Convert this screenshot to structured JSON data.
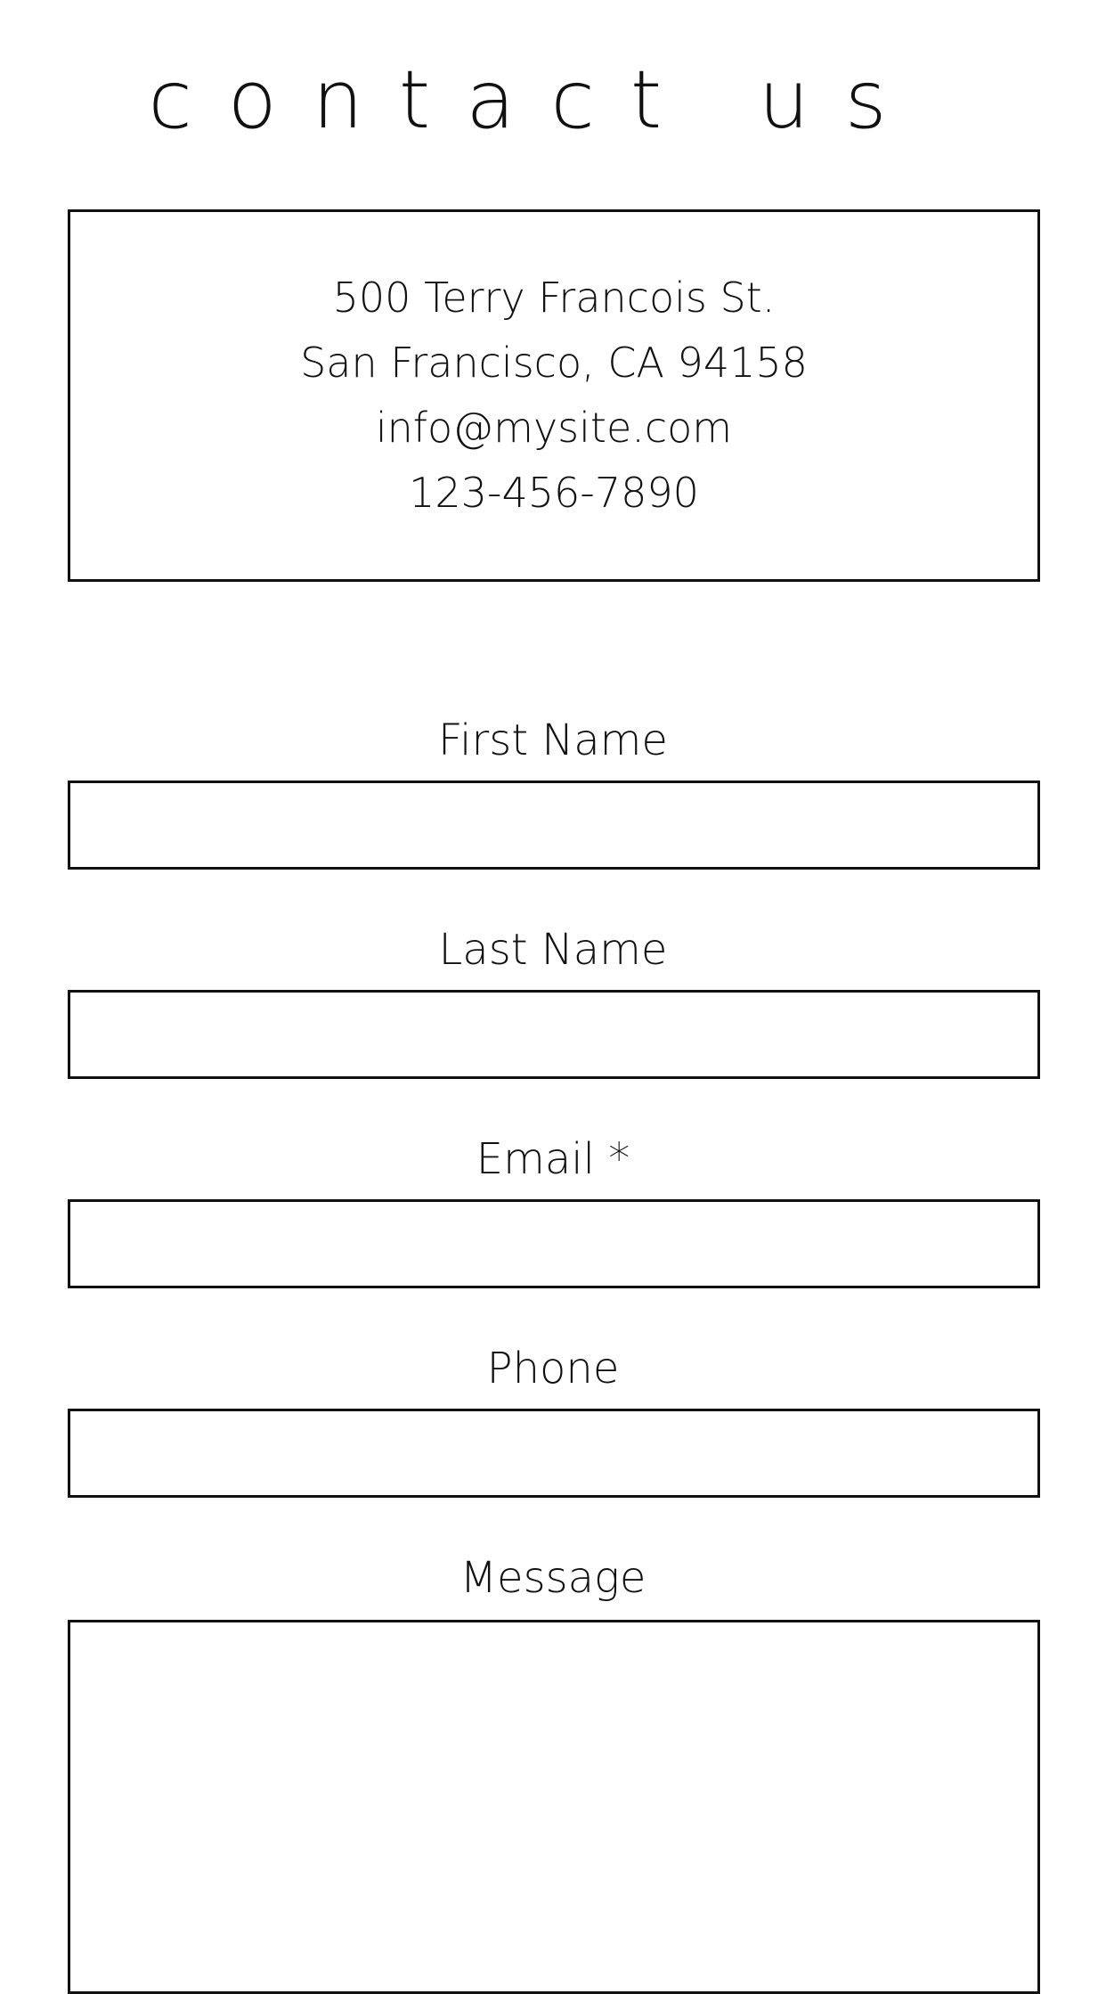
{
  "page": {
    "title": "contact us"
  },
  "contact_info": {
    "address_line1": "500 Terry Francois St.",
    "address_line2": "San Francisco, CA 94158",
    "email": "info@mysite.com",
    "phone": "123-456-7890"
  },
  "form": {
    "first_name": {
      "label": "First Name",
      "value": "",
      "placeholder": ""
    },
    "last_name": {
      "label": "Last Name",
      "value": "",
      "placeholder": ""
    },
    "email": {
      "label": "Email *",
      "value": "",
      "placeholder": ""
    },
    "phone": {
      "label": "Phone",
      "value": "",
      "placeholder": ""
    },
    "message": {
      "label": "Message",
      "value": "",
      "placeholder": ""
    }
  },
  "colors": {
    "text": "#111111",
    "border": "#111111",
    "background": "#ffffff"
  }
}
